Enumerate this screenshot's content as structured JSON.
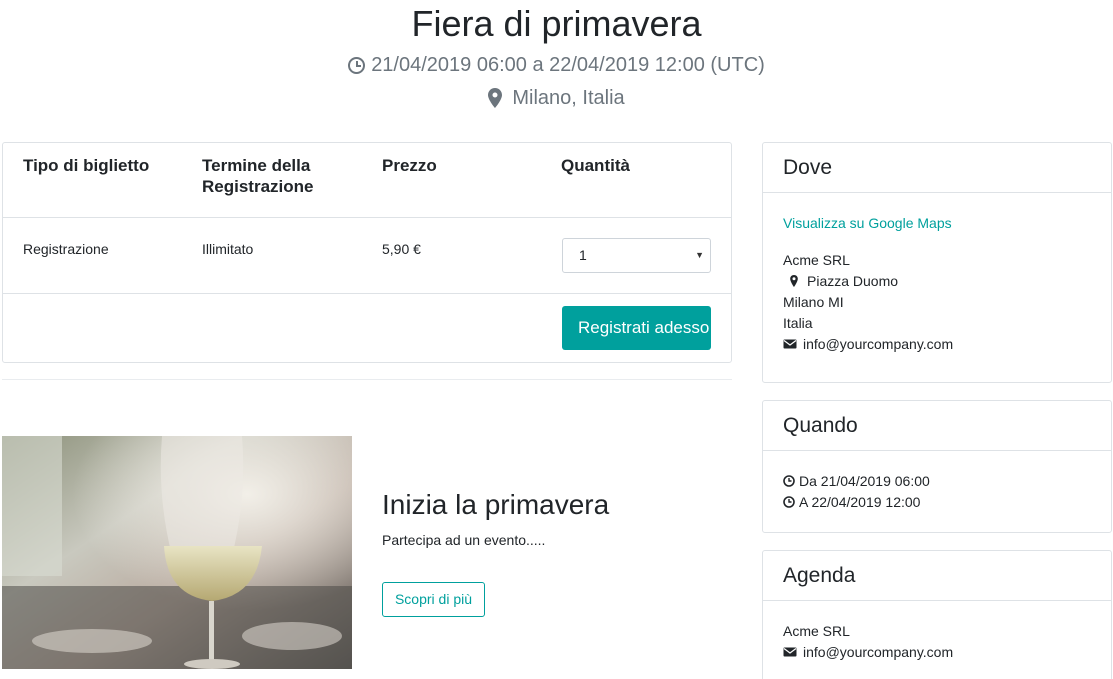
{
  "event": {
    "title": "Fiera di primavera",
    "dates": "21/04/2019 06:00 a 22/04/2019 12:00 (UTC)",
    "location": "Milano, Italia"
  },
  "tickets": {
    "headers": {
      "type": "Tipo di biglietto",
      "deadline_line1": "Termine della",
      "deadline_line2": "Registrazione",
      "price": "Prezzo",
      "quantity": "Quantità"
    },
    "rows": [
      {
        "type": "Registrazione",
        "deadline": "Illimitato",
        "price": "5,90 €",
        "quantity": "1"
      }
    ],
    "register_label": "Registrati adesso"
  },
  "promo": {
    "title": "Inizia la primavera",
    "text": "Partecipa ad un evento.....",
    "button_label": "Scopri di più"
  },
  "sidebar": {
    "where": {
      "title": "Dove",
      "maps_link": "Visualizza su Google Maps",
      "company": "Acme SRL",
      "street": "Piazza Duomo",
      "city": "Milano MI",
      "country": "Italia",
      "email": "info@yourcompany.com"
    },
    "when": {
      "title": "Quando",
      "from": "Da 21/04/2019 06:00",
      "to": "A 22/04/2019 12:00"
    },
    "agenda": {
      "title": "Agenda",
      "company": "Acme SRL",
      "email": "info@yourcompany.com"
    }
  },
  "colors": {
    "accent": "#00a09d",
    "muted": "#6c757d",
    "border": "#dee2e6"
  },
  "icons": [
    "clock-icon",
    "map-marker-icon",
    "envelope-icon",
    "caret-down-icon"
  ]
}
